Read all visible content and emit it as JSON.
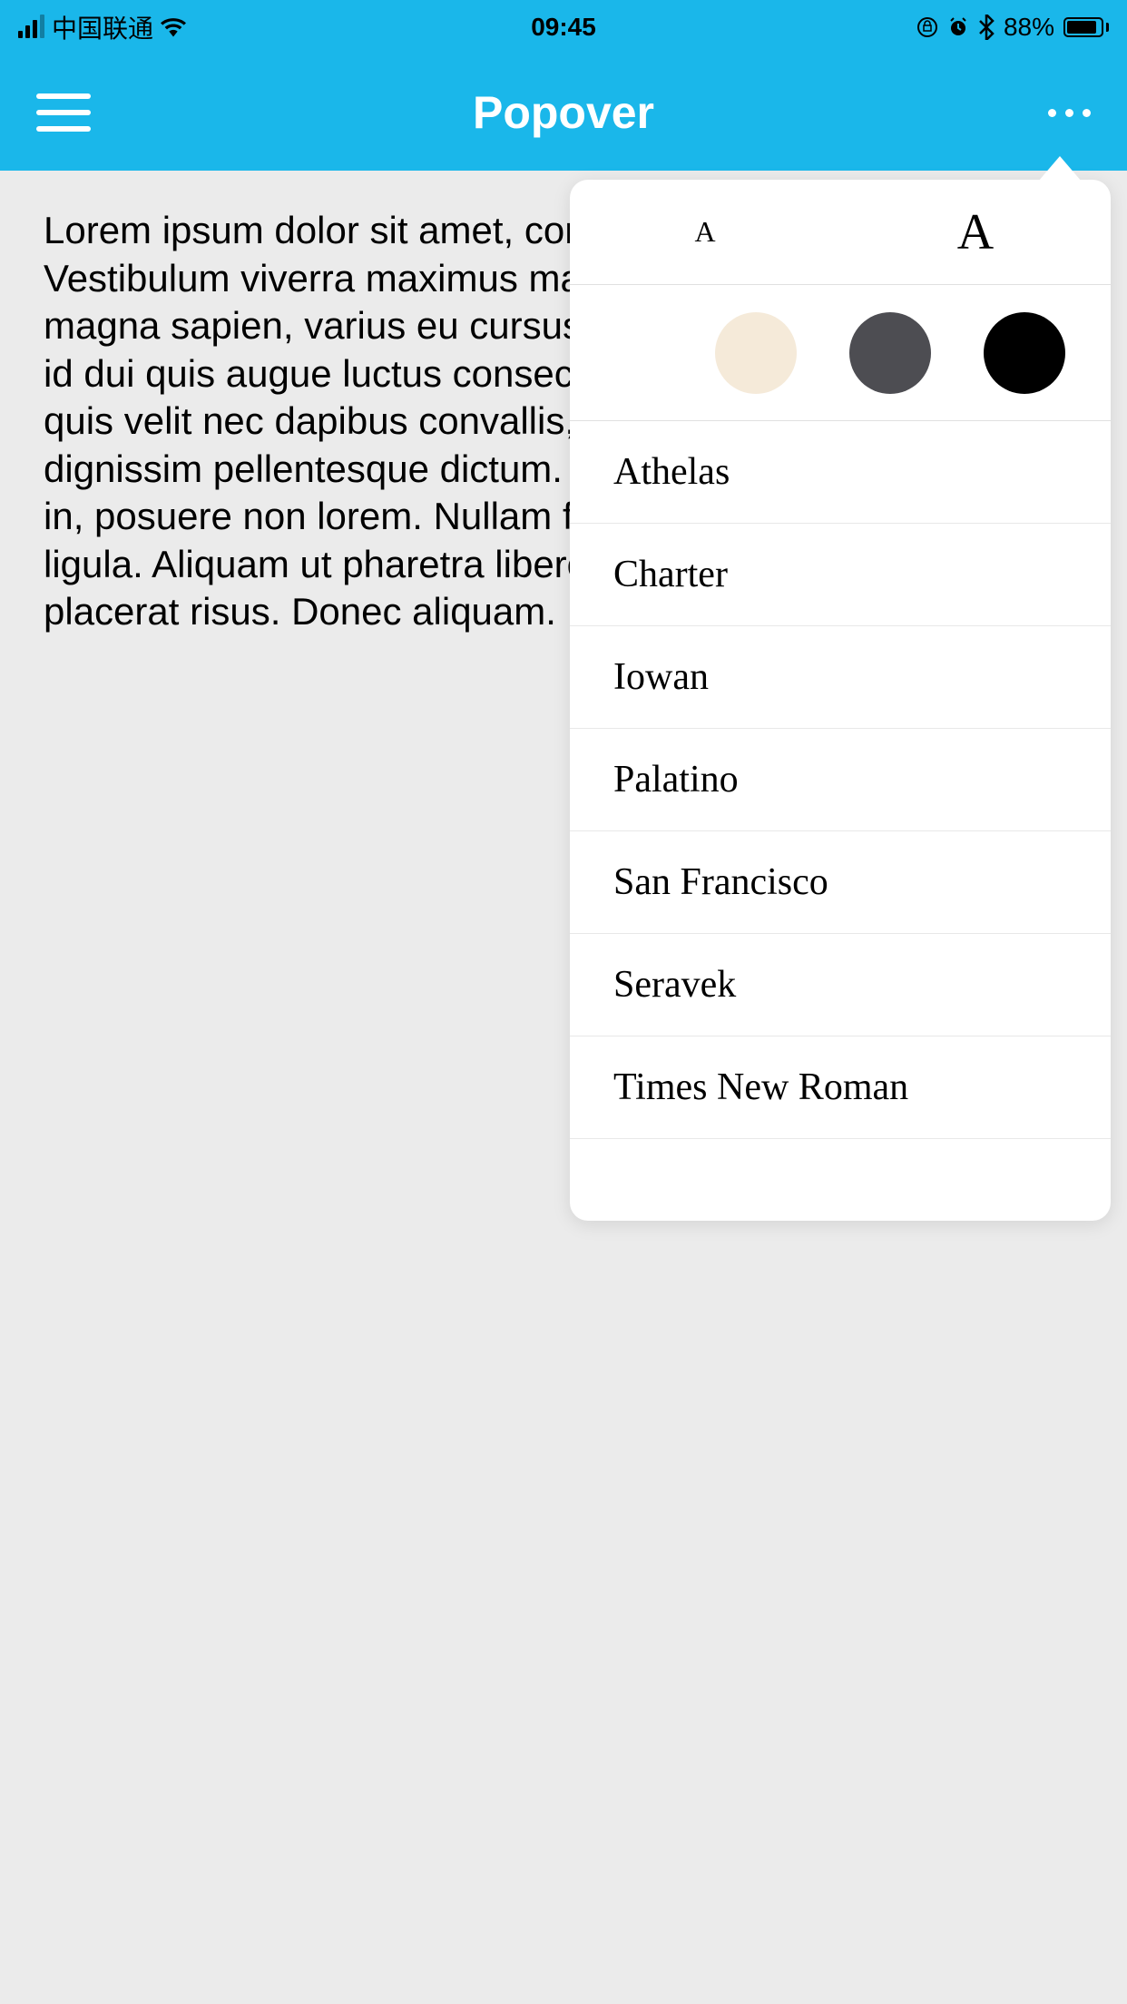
{
  "status_bar": {
    "carrier": "中国联通",
    "time": "09:45",
    "battery_pct": "88%"
  },
  "nav": {
    "title": "Popover"
  },
  "content": {
    "body": "Lorem ipsum dolor sit amet, consectetur adipiscing elit. Vestibulum viverra maximus mauris eget placerat. Maecenas magna sapien, varius eu cursus ac, hendrerit vitae nibh. Cras id dui quis augue luctus consectetur, pellentesque felis tellus quis velit nec dapibus convallis, sodales ac lectus. Fusce dignissim pellentesque dictum. Donec sed mi at pellentesque in, posuere non lorem. Nullam fermentum urna, quis luctus ligula. Aliquam ut pharetra libero ac hendrerit. Nunc sit amet placerat risus. Donec aliquam."
  },
  "popover": {
    "size_small_label": "A",
    "size_large_label": "A",
    "colors": {
      "sepia": "#f5ead9",
      "gray": "#4d4d52",
      "black": "#000000"
    },
    "fonts": [
      "Athelas",
      "Charter",
      "Iowan",
      "Palatino",
      "San Francisco",
      "Seravek",
      "Times New Roman"
    ]
  }
}
